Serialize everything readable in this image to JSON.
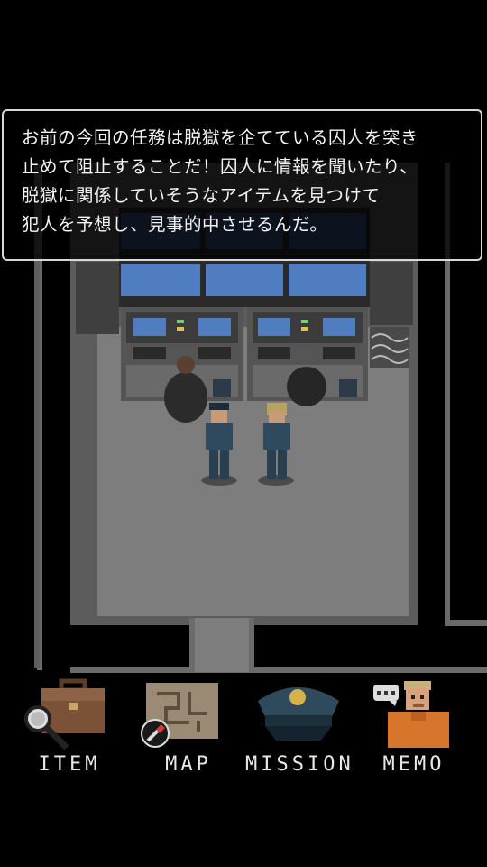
{
  "dialog": {
    "lines": [
      "お前の今回の任務は脱獄を企てている囚人を突き",
      "止めて阻止することだ！囚人に情報を聞いたり、",
      "脱獄に関係していそうなアイテムを見つけて",
      "犯人を予想し、見事的中させるんだ。"
    ]
  },
  "menu": {
    "item_label": "ITEM",
    "map_label": "MAP",
    "mission_label": "MISSION",
    "memo_label": "MEMO"
  },
  "colors": {
    "screen_blue": "#4f7dbf",
    "floor_gray": "#7a7a7a",
    "uniform_blue": "#2f4a5c"
  },
  "icons": {
    "item": "briefcase-magnifier-icon",
    "map": "map-pen-icon",
    "mission": "police-cap-icon",
    "memo": "prisoner-speech-icon"
  }
}
